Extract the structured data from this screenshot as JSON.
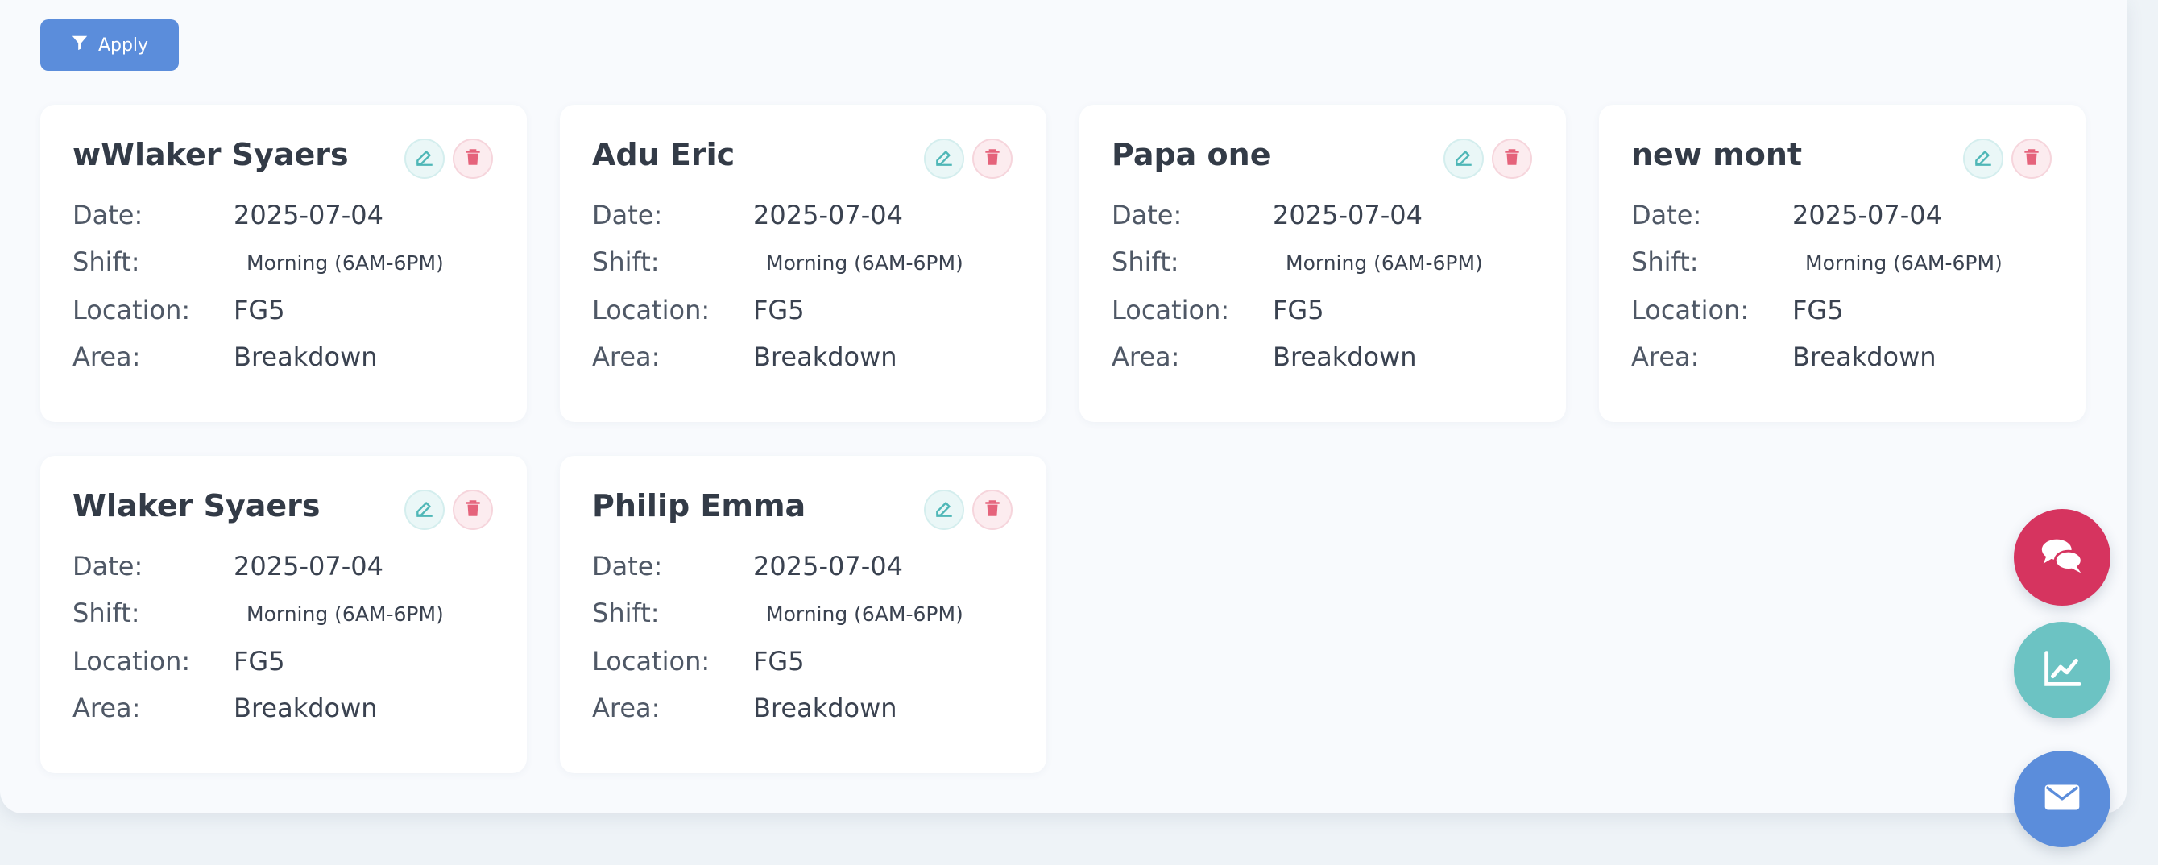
{
  "toolbar": {
    "apply_label": "Apply"
  },
  "labels": {
    "date": "Date:",
    "shift": "Shift:",
    "location": "Location:",
    "area": "Area:"
  },
  "cards": [
    {
      "name": "wWlaker Syaers",
      "date": "2025-07-04",
      "shift": "Morning (6AM-6PM)",
      "location": "FG5",
      "area": "Breakdown"
    },
    {
      "name": "Adu Eric",
      "date": "2025-07-04",
      "shift": "Morning (6AM-6PM)",
      "location": "FG5",
      "area": "Breakdown"
    },
    {
      "name": "Papa one",
      "date": "2025-07-04",
      "shift": "Morning (6AM-6PM)",
      "location": "FG5",
      "area": "Breakdown"
    },
    {
      "name": "new mont",
      "date": "2025-07-04",
      "shift": "Morning (6AM-6PM)",
      "location": "FG5",
      "area": "Breakdown"
    },
    {
      "name": "Wlaker Syaers",
      "date": "2025-07-04",
      "shift": "Morning (6AM-6PM)",
      "location": "FG5",
      "area": "Breakdown"
    },
    {
      "name": "Philip Emma",
      "date": "2025-07-04",
      "shift": "Morning (6AM-6PM)",
      "location": "FG5",
      "area": "Breakdown"
    }
  ],
  "icons": {
    "apply": "filter-icon",
    "edit": "edit-icon",
    "delete": "trash-icon",
    "chat": "comments-icon",
    "chart": "line-chart-icon",
    "mail": "envelope-icon"
  },
  "colors": {
    "primary": "#5b8ddb",
    "teal": "#6cc3c3",
    "danger": "#e5637b",
    "chat": "#d6345f"
  }
}
